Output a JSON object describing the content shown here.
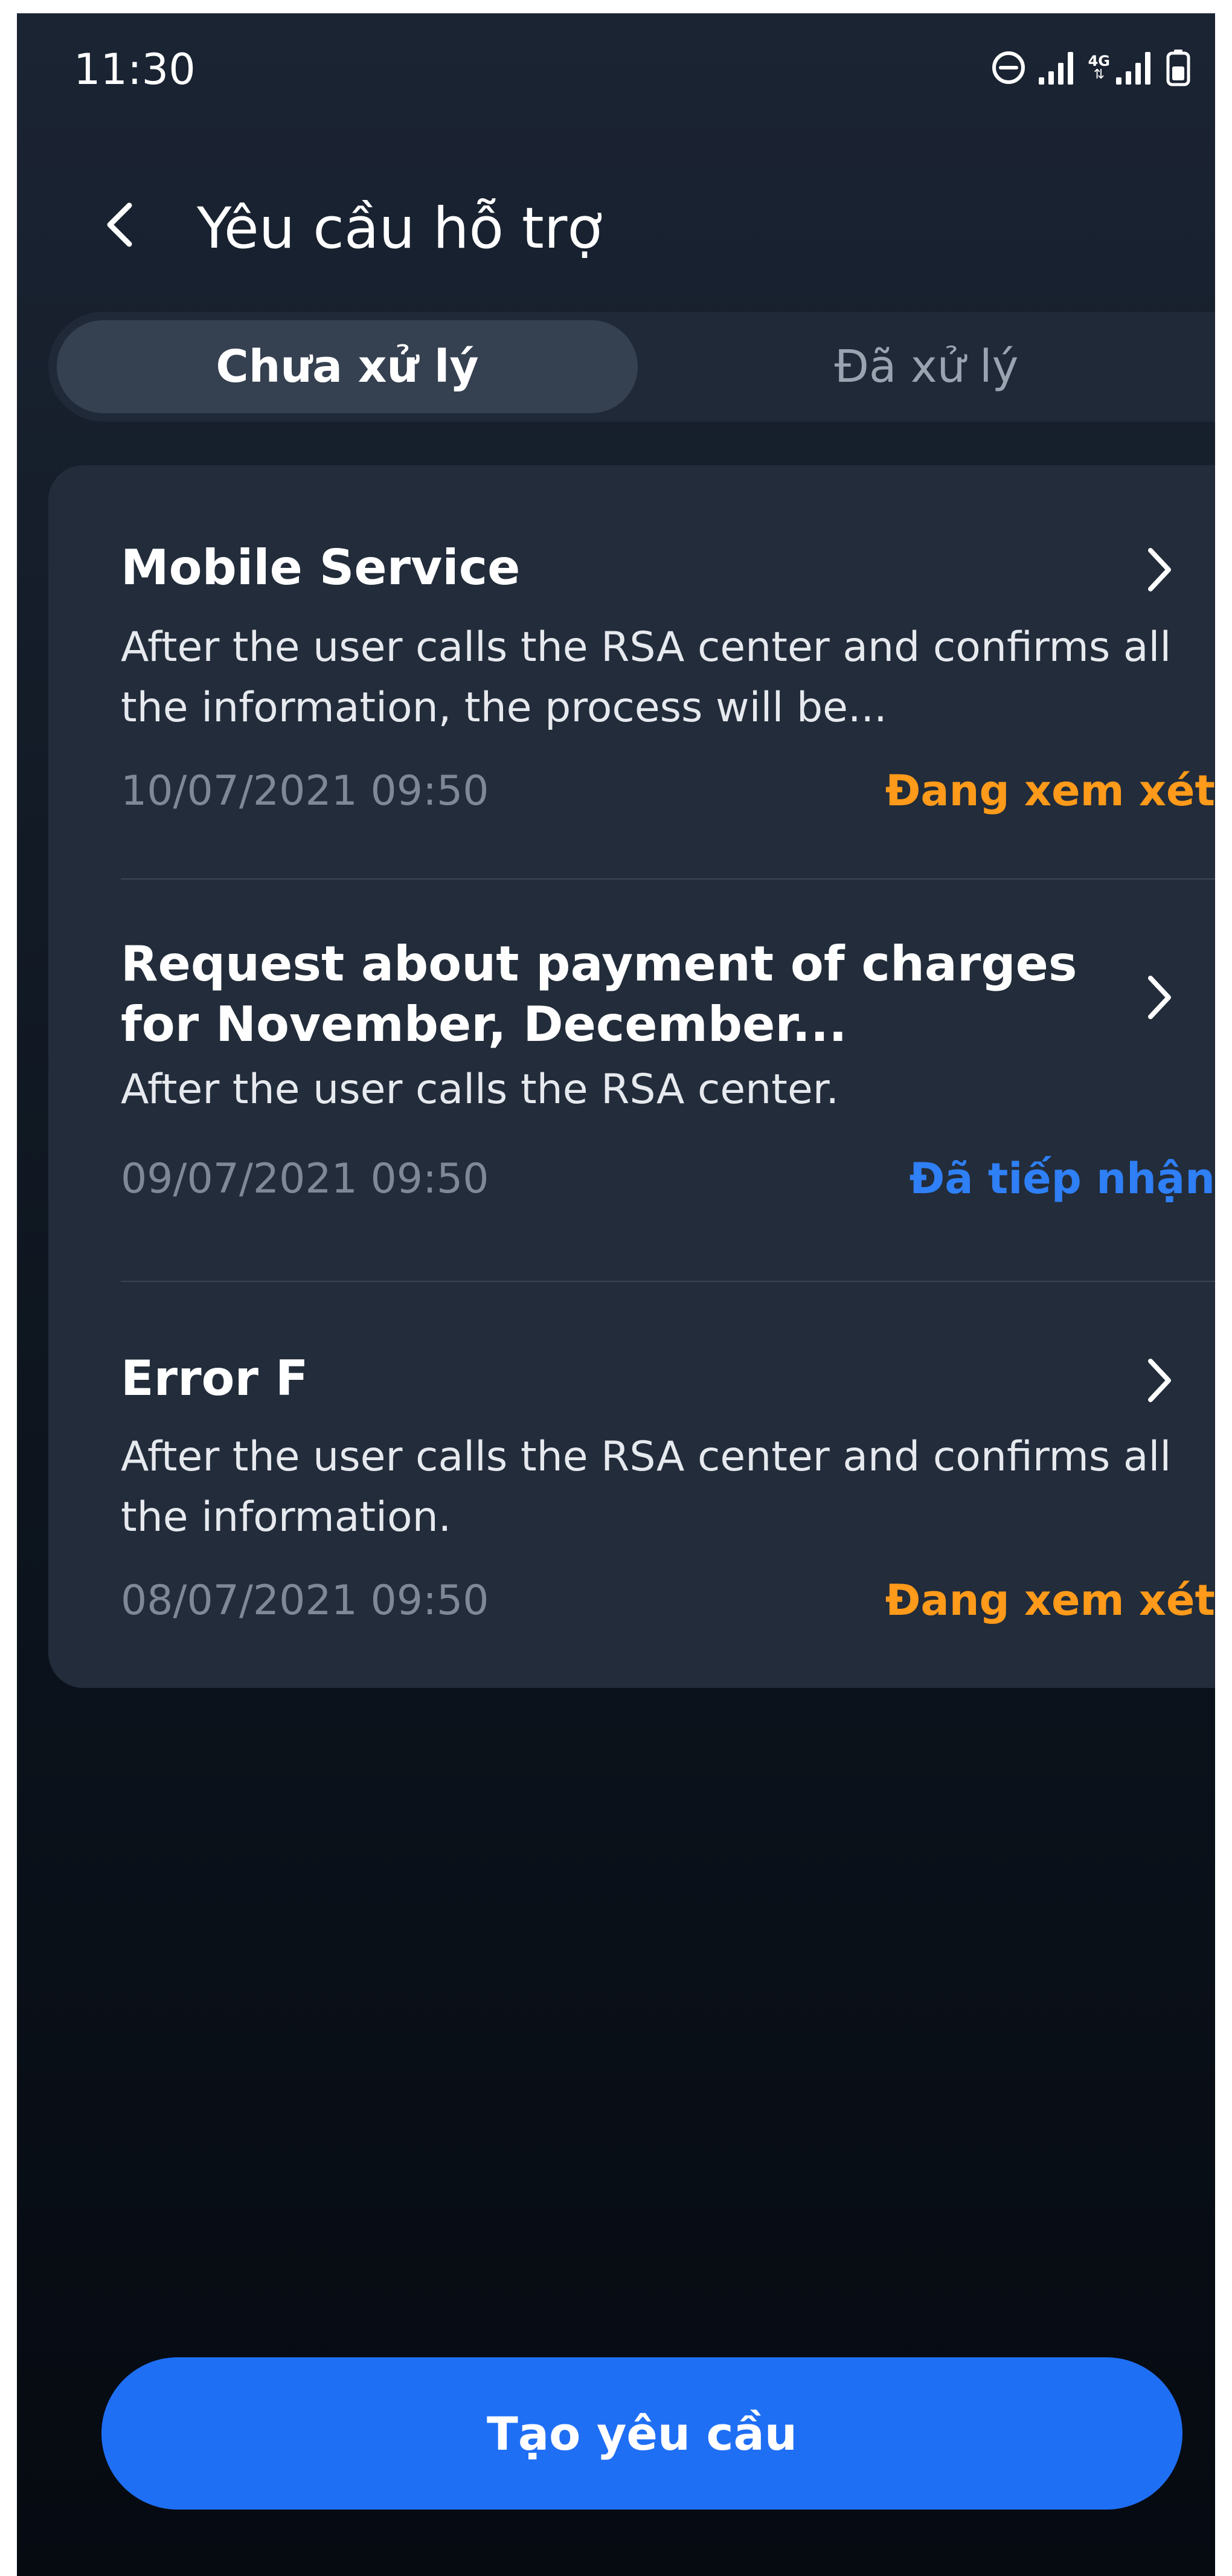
{
  "status_bar": {
    "time": "11:30",
    "network_label": "4G",
    "icons": [
      "do-not-disturb-icon",
      "signal-icon",
      "4g-signal-icon",
      "battery-icon"
    ]
  },
  "header": {
    "back_icon": "chevron-left-icon",
    "title": "Yêu cầu hỗ trợ"
  },
  "tabs": [
    {
      "label": "Chưa xử lý",
      "selected": true
    },
    {
      "label": "Đã xử lý",
      "selected": false
    }
  ],
  "requests": [
    {
      "title_lines": [
        "Mobile Service"
      ],
      "description": "After the user calls the RSA center and confirms all the information, the process will be...",
      "date": "10/07/2021 09:50",
      "status": "Đang xem xét",
      "status_color": "#ff9a1a"
    },
    {
      "title_lines": [
        "Request about payment of charges",
        "for November, December..."
      ],
      "description": "After the user calls the RSA center.",
      "date": "09/07/2021 09:50",
      "status": "Đã tiếp nhận",
      "status_color": "#2f7ff6"
    },
    {
      "title_lines": [
        "Error F"
      ],
      "description": "After the user calls the RSA center and confirms all the information.",
      "date": "08/07/2021 09:50",
      "status": "Đang xem xét",
      "status_color": "#ff9a1a"
    }
  ],
  "create_button": {
    "label": "Tạo yêu cầu",
    "color": "#1f6ff5"
  }
}
